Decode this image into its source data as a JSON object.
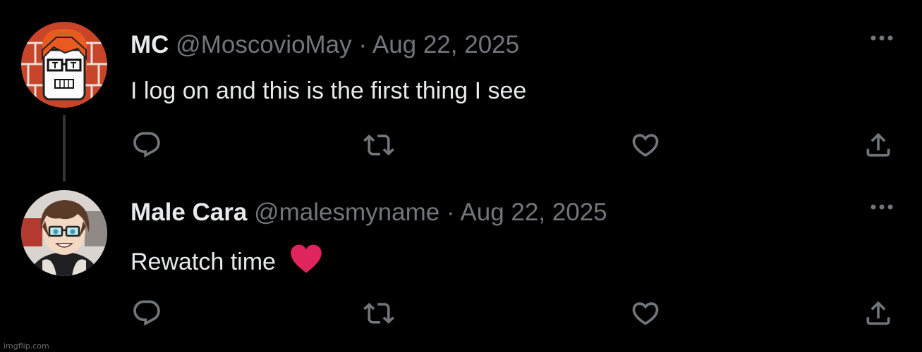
{
  "colors": {
    "background": "#000000",
    "primary_text": "#e7e9ea",
    "secondary_text": "#71767b",
    "icon": "#71767b",
    "thread_line": "#333639",
    "heart_emoji": "#e0245e"
  },
  "posts": [
    {
      "display_name": "MC",
      "handle": "@MoscovioMay",
      "separator": "·",
      "date": "Aug 22, 2025",
      "text": "I log on and this is the first thing I see",
      "avatar_icon": "cartoon-avatar-orange-hair-glasses",
      "icons": {
        "more": "more-horizontal-icon",
        "reply": "reply-icon",
        "repost": "repost-icon",
        "like": "heart-outline-icon",
        "share": "share-icon"
      }
    },
    {
      "display_name": "Male Cara",
      "handle": "@malesmyname",
      "separator": "·",
      "date": "Aug 22, 2025",
      "text": "Rewatch time",
      "emoji": "red-heart-emoji",
      "avatar_icon": "anime-avatar-brown-hair-glasses",
      "icons": {
        "more": "more-horizontal-icon",
        "reply": "reply-icon",
        "repost": "repost-icon",
        "like": "heart-outline-icon",
        "share": "share-icon"
      }
    }
  ],
  "watermark": "imgflip.com"
}
